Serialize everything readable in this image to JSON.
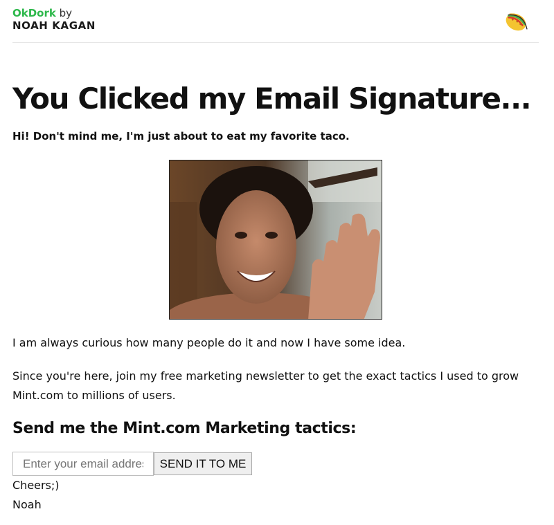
{
  "header": {
    "brand_primary": "OkDork",
    "brand_by": "by",
    "brand_name": "NOAH KAGAN",
    "logo_icon": "taco-icon"
  },
  "main": {
    "title": "You Clicked my Email Signature...",
    "intro": "Hi! Don't mind me, I'm just about to eat my favorite taco.",
    "photo_icon": "waving-person-photo",
    "paragraph1": "I am always curious how many people do it and now I have some idea.",
    "paragraph2": "Since you're here, join my free marketing newsletter to get the exact tactics I used to grow Mint.com to millions of users.",
    "signup_heading": "Send me the Mint.com Marketing tactics:"
  },
  "form": {
    "email_placeholder": "Enter your email address",
    "email_value": "",
    "submit_label": "SEND IT TO ME"
  },
  "signoff": {
    "line1": "Cheers;)",
    "line2": "Noah"
  },
  "colors": {
    "brand_green": "#2db84b",
    "text": "#111111",
    "divider": "#e6e6e6",
    "button_bg": "#efefef"
  }
}
